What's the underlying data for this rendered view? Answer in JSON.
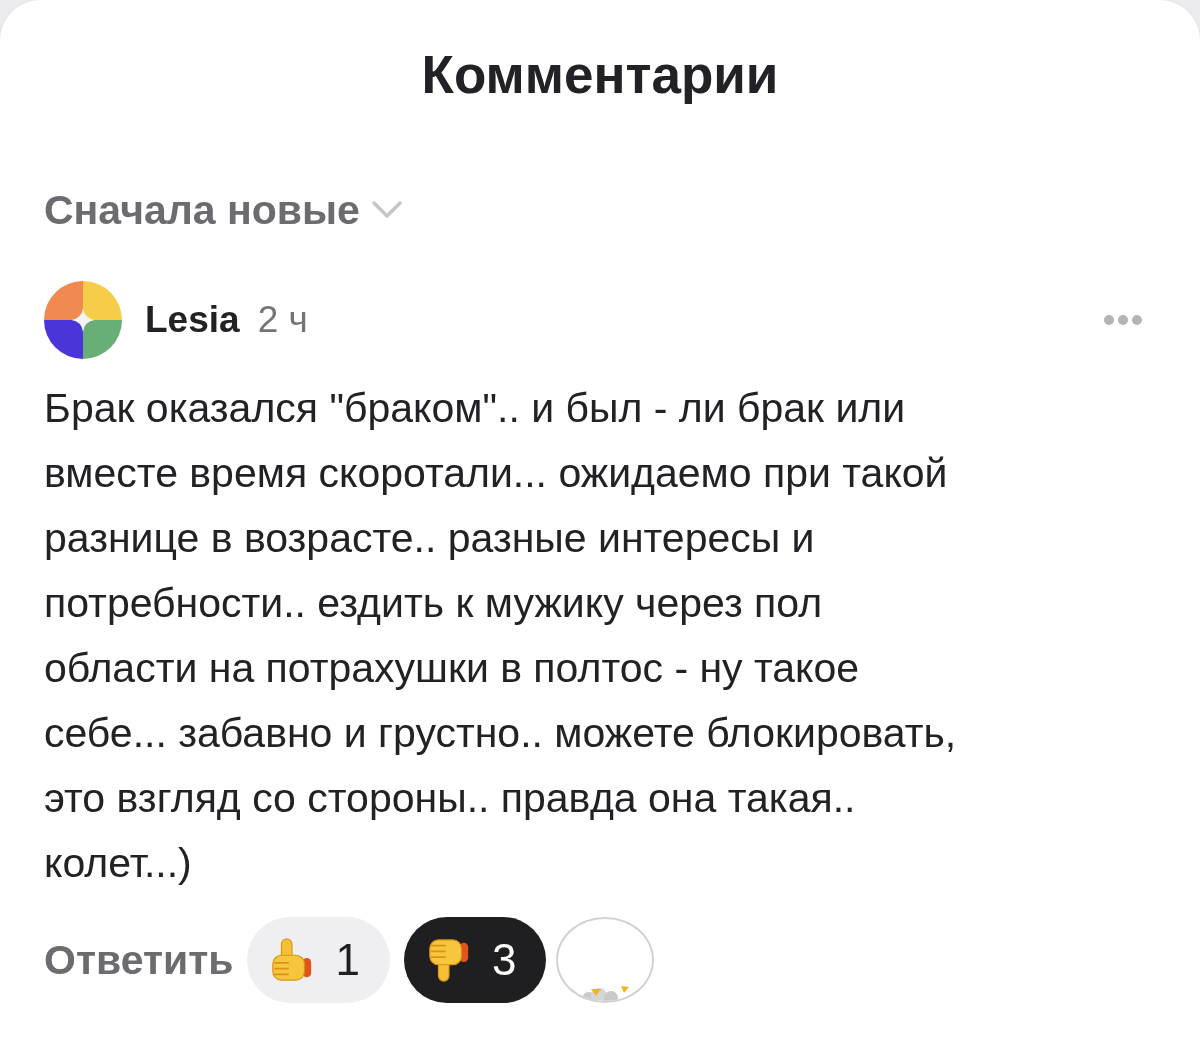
{
  "header": {
    "title": "Комментарии"
  },
  "sort": {
    "label": "Сначала новые"
  },
  "comments": [
    {
      "author": "Lesia",
      "time": "2 ч",
      "text": "Брак оказался \"браком\".. и был - ли брак или\nвместе время скоротали... ожидаемо при такой\nразнице в возрасте.. разные интересы и\nпотребности.. ездить к мужику через пол\nобласти на потрахушки в полтос - ну такое\nсебе... забавно и грустно.. можете блокировать,\nэто взгляд со стороны.. правда она такая..\nколет...)",
      "reply": "Ответить",
      "reactions": [
        {
          "kind": "like",
          "count": "1",
          "selected": false
        },
        {
          "kind": "dislike",
          "count": "3",
          "selected": true
        },
        {
          "kind": "add",
          "selected": false
        }
      ]
    }
  ]
}
